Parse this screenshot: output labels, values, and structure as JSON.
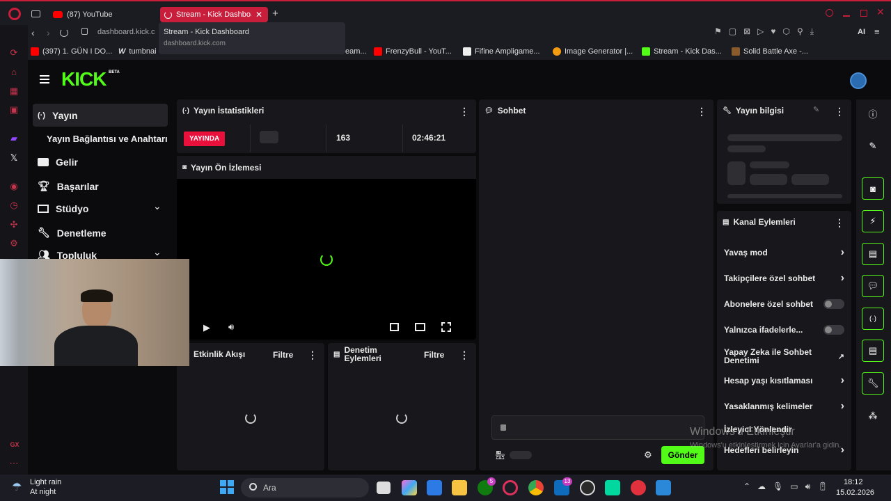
{
  "browser": {
    "tabs": [
      {
        "label": "(87) YouTube"
      },
      {
        "label": "Stream - Kick Dashboard"
      }
    ],
    "address": {
      "domain": "dashboard.kick.c"
    },
    "tooltip": {
      "title": "Stream - Kick Dashboard",
      "url": "dashboard.kick.com"
    },
    "bookmarks": [
      "(397) 1. GÜN I DO...",
      "tumbnai",
      "eam...",
      "FrenzyBull - YouT...",
      "Fifine Ampligame...",
      "Image Generator |...",
      "Stream - Kick Das...",
      "Solid Battle Axe -..."
    ],
    "ai_label": "AI",
    "gx_label": "GX"
  },
  "kick": {
    "logo": "KICK",
    "beta": "BETA",
    "nav": {
      "yayin": "Yayın",
      "baglanti": "Yayın Bağlantısı ve Anahtarı",
      "gelir": "Gelir",
      "basarilar": "Başarılar",
      "studyo": "Stüdyo",
      "denetleme": "Denetleme",
      "topluluk": "Topluluk"
    },
    "stats": {
      "title": "Yayın İstatistikleri",
      "live": "YAYINDA",
      "viewers": "163",
      "uptime": "02:46:21"
    },
    "preview": {
      "title": "Yayın Ön İzlemesi"
    },
    "activity": {
      "title": "Etkinlik Akışı",
      "filter": "Filtre"
    },
    "modactions": {
      "title": "Denetim Eylemleri",
      "filter": "Filtre"
    },
    "chat": {
      "title": "Sohbet",
      "send": "Gönder"
    },
    "info": {
      "title": "Yayın bilgisi"
    },
    "channel": {
      "title": "Kanal Eylemleri",
      "items": [
        "Yavaş mod",
        "Takipçilere özel sohbet",
        "Abonelere özel sohbet",
        "Yalnızca ifadelerle...",
        "Yapay Zeka ile Sohbet Denetimi",
        "Hesap yaşı kısıtlaması",
        "Yasaklanmış kelimeler",
        "İzleyici Yönlendir",
        "Hedefleri belirleyin"
      ]
    }
  },
  "windows": {
    "activate_title": "Windows'u Etkinleştir",
    "activate_sub": "Windows'u etkinleştirmek için Ayarlar'a gidin."
  },
  "taskbar": {
    "weather_title": "Light rain",
    "weather_sub": "At night",
    "search": "Ara",
    "time": "18:12",
    "date": "15.02.2026",
    "badge_xbox": "5",
    "badge_mail": "13"
  },
  "colors": {
    "accent": "#53fc18",
    "live": "#e9113c",
    "opera": "#c81e3c"
  }
}
